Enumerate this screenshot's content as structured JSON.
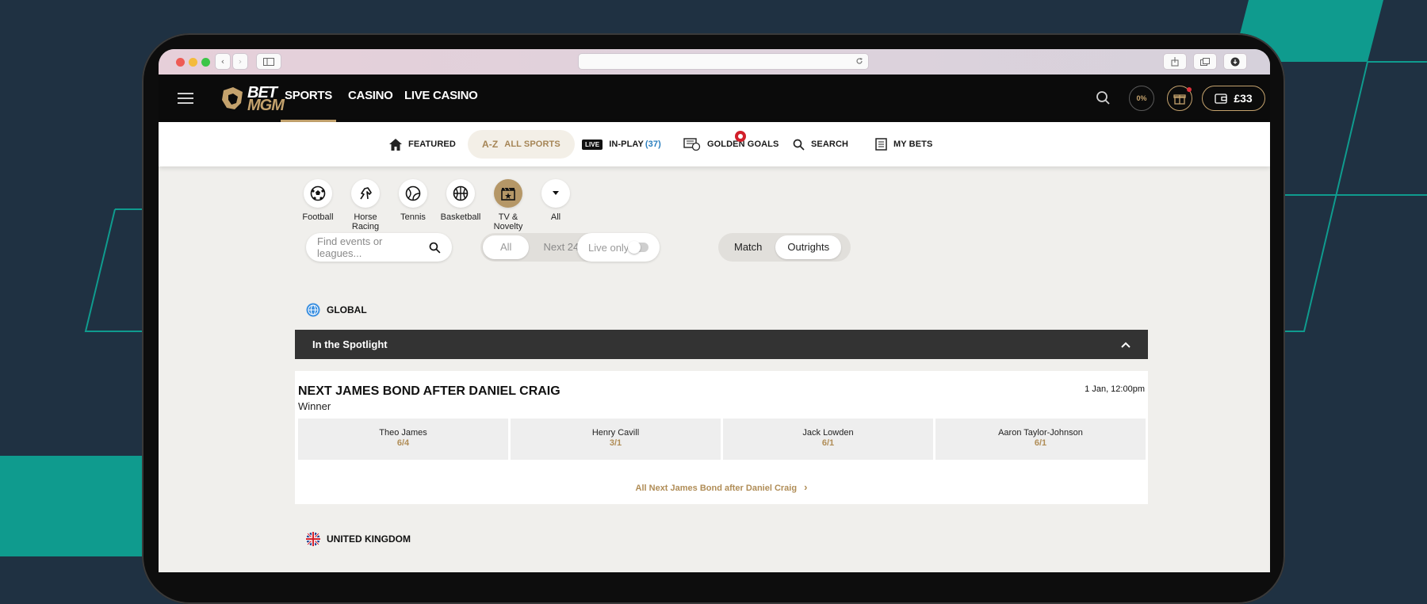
{
  "topnav": {
    "logo_top": "BET",
    "logo_bottom": "MGM",
    "items": [
      {
        "label": "SPORTS",
        "active": true
      },
      {
        "label": "CASINO"
      },
      {
        "label": "LIVE CASINO"
      }
    ],
    "progress_label": "0%",
    "balance": "£33"
  },
  "subnav": {
    "featured": "FEATURED",
    "all_sports": "ALL SPORTS",
    "az": "A-Z",
    "live_badge": "LIVE",
    "in_play": "IN-PLAY",
    "in_play_count": "(37)",
    "golden_goals": "GOLDEN GOALS",
    "search": "SEARCH",
    "my_bets": "MY BETS"
  },
  "sports": [
    {
      "label": "Football",
      "icon": "football-icon"
    },
    {
      "label": "Horse Racing",
      "icon": "horse-icon"
    },
    {
      "label": "Tennis",
      "icon": "tennis-icon"
    },
    {
      "label": "Basketball",
      "icon": "basketball-icon"
    },
    {
      "label": "TV & Novelty",
      "icon": "tv-icon",
      "active": true
    },
    {
      "label": "All",
      "icon": "chevron-down-icon"
    }
  ],
  "filters": {
    "search_placeholder": "Find events or leagues...",
    "time_all": "All",
    "time_next": "Next 24h",
    "live_only": "Live only",
    "match": "Match",
    "outrights": "Outrights"
  },
  "regions": {
    "global": "GLOBAL",
    "uk": "UNITED KINGDOM"
  },
  "spotlight": {
    "title": "In the Spotlight"
  },
  "event": {
    "title": "NEXT JAMES BOND AFTER DANIEL CRAIG",
    "market": "Winner",
    "time": "1 Jan, 12:00pm",
    "selections": [
      {
        "name": "Theo James",
        "price": "6/4"
      },
      {
        "name": "Henry Cavill",
        "price": "3/1"
      },
      {
        "name": "Jack Lowden",
        "price": "6/1"
      },
      {
        "name": "Aaron Taylor-Johnson",
        "price": "6/1"
      }
    ],
    "all_link": "All Next James Bond after Daniel Craig"
  },
  "colors": {
    "accent_gold": "#c4a26d",
    "background": "#1f3142",
    "teal": "#0f9b8e"
  }
}
